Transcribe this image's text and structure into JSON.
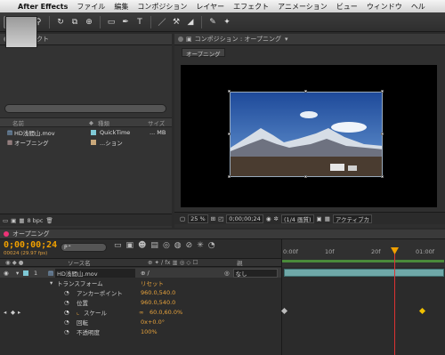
{
  "menubar": {
    "app_name": "After Effects",
    "items": [
      "ファイル",
      "編集",
      "コンポジション",
      "レイヤー",
      "エフェクト",
      "アニメーション",
      "ビュー",
      "ウィンドウ",
      "ヘル"
    ]
  },
  "project_panel": {
    "tab_label": "プロジェクト",
    "columns": {
      "name": "名前",
      "type": "種類",
      "size": "サイズ"
    },
    "items": [
      {
        "name": "HD浅間山.mov",
        "type": "QuickTime",
        "size": "... MB",
        "label_color": "#7fc9d6"
      },
      {
        "name": "オープニング",
        "type": "...ション",
        "size": "",
        "label_color": "#c9a87a"
      }
    ],
    "bpc": "8 bpc"
  },
  "comp_panel": {
    "tab_label": "コンポジション : オープニング",
    "sub_tab": "オープニング",
    "zoom": "25 %",
    "timecode": "0;00;00;24",
    "resolution": "(1/4 画質)",
    "camera": "アクティブカ"
  },
  "timeline": {
    "tab_label": "オープニング",
    "timecode": "0;00;00;24",
    "fps_info": "00024 (29.97 fps)",
    "search_placeholder": "P⌃",
    "columns": {
      "source": "ソース名",
      "parent": "親"
    },
    "layer": {
      "index": "1",
      "name": "HD浅間山.mov",
      "parent": "なし"
    },
    "transform_label": "トランスフォーム",
    "reset_label": "リセット",
    "properties": [
      {
        "name": "アンカーポイント",
        "value": "960.0,540.0"
      },
      {
        "name": "位置",
        "value": "960.0,540.0"
      },
      {
        "name": "スケール",
        "value": "60.0,60.0%"
      },
      {
        "name": "回転",
        "value": "0x+0.0°"
      },
      {
        "name": "不透明度",
        "value": "100%"
      }
    ],
    "ruler_ticks": [
      "0:00f",
      "10f",
      "20f",
      "01:00f"
    ]
  },
  "colors": {
    "accent": "#f0a000",
    "playhead": "#dd3333",
    "layer_bar": "#6fa8a8"
  }
}
